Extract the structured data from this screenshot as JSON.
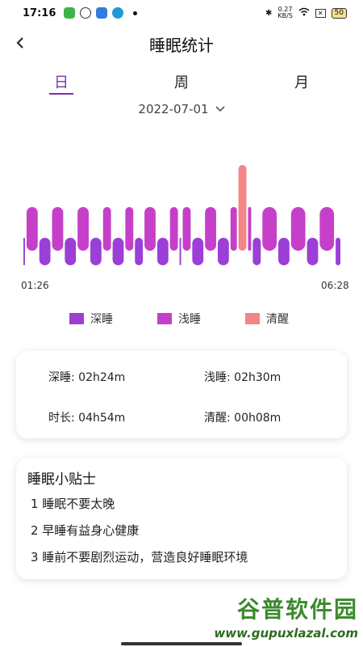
{
  "status_bar": {
    "time": "17:16",
    "speed_value": "0.27",
    "speed_unit": "KB/S",
    "battery": "50"
  },
  "header": {
    "title": "睡眠统计"
  },
  "tabs": [
    {
      "label": "日",
      "active": true
    },
    {
      "label": "周",
      "active": false
    },
    {
      "label": "月",
      "active": false
    }
  ],
  "date": "2022-07-01",
  "chart_data": {
    "type": "area",
    "x_start_label": "01:26",
    "x_end_label": "06:28",
    "levels": [
      "深睡",
      "浅睡",
      "清醒"
    ],
    "segments": [
      {
        "stage": "深睡",
        "start": 0.0,
        "end": 0.01
      },
      {
        "stage": "浅睡",
        "start": 0.01,
        "end": 0.05
      },
      {
        "stage": "深睡",
        "start": 0.05,
        "end": 0.09
      },
      {
        "stage": "浅睡",
        "start": 0.09,
        "end": 0.13
      },
      {
        "stage": "深睡",
        "start": 0.13,
        "end": 0.17
      },
      {
        "stage": "浅睡",
        "start": 0.17,
        "end": 0.21
      },
      {
        "stage": "深睡",
        "start": 0.21,
        "end": 0.25
      },
      {
        "stage": "浅睡",
        "start": 0.25,
        "end": 0.28
      },
      {
        "stage": "深睡",
        "start": 0.28,
        "end": 0.32
      },
      {
        "stage": "浅睡",
        "start": 0.32,
        "end": 0.35
      },
      {
        "stage": "深睡",
        "start": 0.35,
        "end": 0.38
      },
      {
        "stage": "浅睡",
        "start": 0.38,
        "end": 0.42
      },
      {
        "stage": "深睡",
        "start": 0.42,
        "end": 0.46
      },
      {
        "stage": "浅睡",
        "start": 0.46,
        "end": 0.49
      },
      {
        "stage": "深睡",
        "start": 0.49,
        "end": 0.5
      },
      {
        "stage": "浅睡",
        "start": 0.5,
        "end": 0.53
      },
      {
        "stage": "深睡",
        "start": 0.53,
        "end": 0.57
      },
      {
        "stage": "浅睡",
        "start": 0.57,
        "end": 0.61
      },
      {
        "stage": "深睡",
        "start": 0.61,
        "end": 0.65
      },
      {
        "stage": "浅睡",
        "start": 0.65,
        "end": 0.675
      },
      {
        "stage": "清醒",
        "start": 0.675,
        "end": 0.705
      },
      {
        "stage": "浅睡",
        "start": 0.705,
        "end": 0.72
      },
      {
        "stage": "深睡",
        "start": 0.72,
        "end": 0.75
      },
      {
        "stage": "浅睡",
        "start": 0.75,
        "end": 0.8
      },
      {
        "stage": "深睡",
        "start": 0.8,
        "end": 0.84
      },
      {
        "stage": "浅睡",
        "start": 0.84,
        "end": 0.89
      },
      {
        "stage": "深睡",
        "start": 0.89,
        "end": 0.93
      },
      {
        "stage": "浅睡",
        "start": 0.93,
        "end": 0.98
      },
      {
        "stage": "深睡",
        "start": 0.98,
        "end": 1.0
      }
    ]
  },
  "legend": [
    {
      "label": "深睡",
      "color": "#9b3fd6"
    },
    {
      "label": "浅睡",
      "color": "#c63fc9"
    },
    {
      "label": "清醒",
      "color": "#f28585"
    }
  ],
  "stats": {
    "deep": "深睡:  02h24m",
    "light": "浅睡:  02h30m",
    "duration": "时长:  04h54m",
    "awake": "清醒:  00h08m"
  },
  "tips": {
    "title": "睡眠小贴士",
    "items": [
      "1 睡眠不要太晚",
      "2 早睡有益身心健康",
      "3 睡前不要剧烈运动，营造良好睡眠环境"
    ]
  },
  "watermark": {
    "text": "谷普软件园",
    "url": "www.gupuxlazal.com"
  },
  "colors": {
    "accent": "#7b2fb5"
  }
}
